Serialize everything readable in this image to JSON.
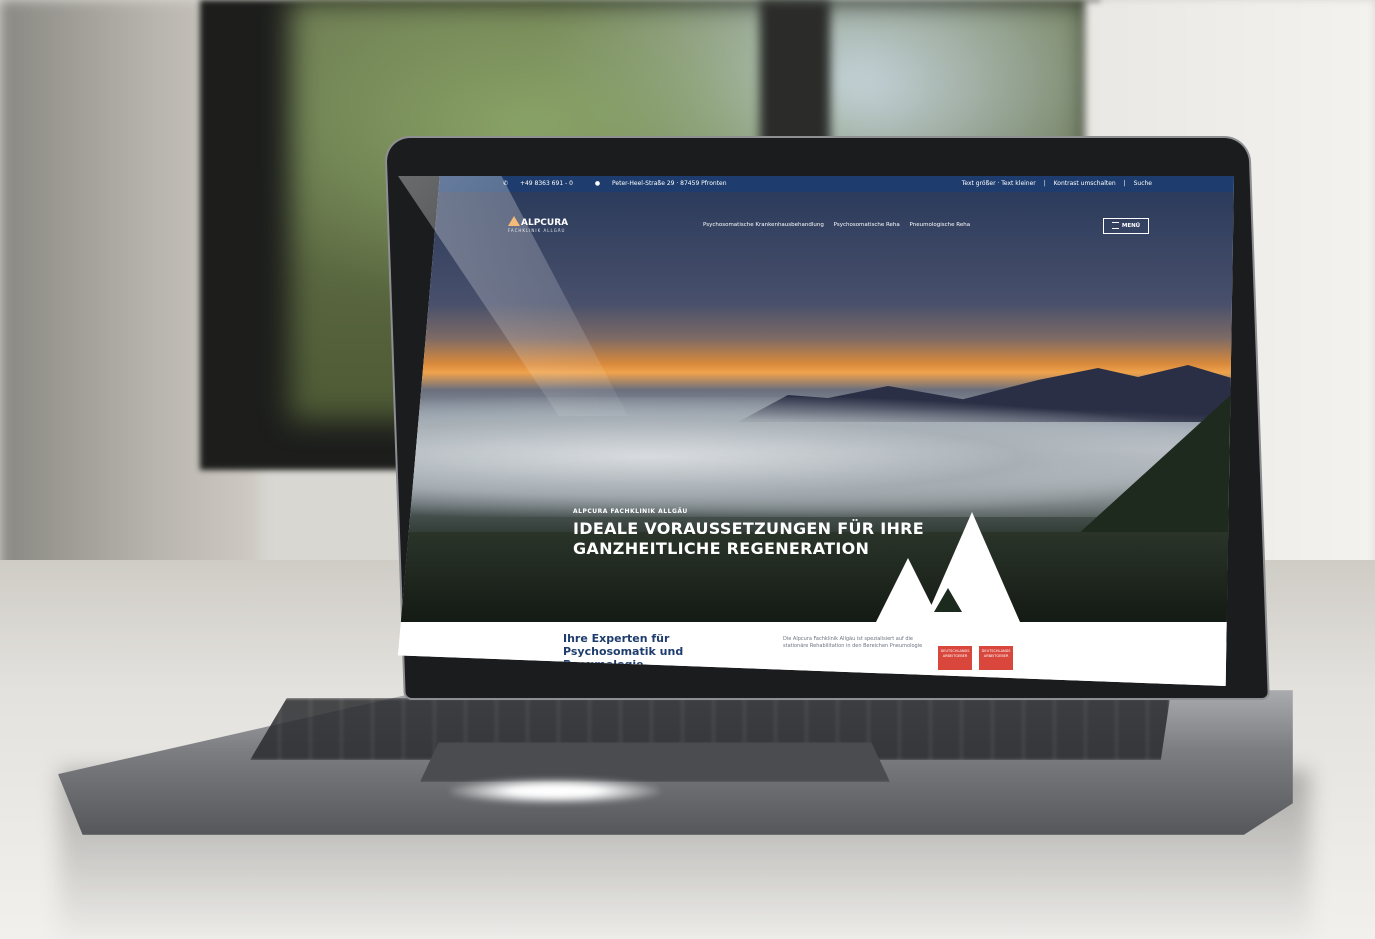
{
  "topbar": {
    "phone": "+49 8363 691 - 0",
    "address": "Peter-Heel-Straße 29 · 87459 Pfronten",
    "text_size": "Text größer · Text kleiner",
    "contrast": "Kontrast umschalten",
    "search": "Suche"
  },
  "nav": {
    "logo": "ALPCURA",
    "logo_sub": "FACHKLINIK ALLGÄU",
    "links": [
      "Psychosomatische Krankenhausbehandlung",
      "Psychosomatische Reha",
      "Pneumologische Reha"
    ],
    "menu_label": "MENÜ"
  },
  "hero": {
    "kicker": "ALPCURA FACHKLINIK ALLGÄU",
    "headline_line1": "IDEALE VORAUSSETZUNGEN FÜR IHRE",
    "headline_line2": "GANZHEITLICHE REGENERATION"
  },
  "content": {
    "heading": "Ihre Experten für Psychosomatik und Pneumologie",
    "text": "Die Alpcura Fachklinik Allgäu ist spezialisiert auf die stationäre Rehabilitation in den Bereichen Pneumologie",
    "badges": [
      "DEUTSCHLANDS ARBEITGEBER",
      "DEUTSCHLANDS ARBEITGEBER"
    ]
  },
  "colors": {
    "topbar": "#1e3d6e",
    "accent": "#f0a34c",
    "badge": "#d9463c"
  }
}
